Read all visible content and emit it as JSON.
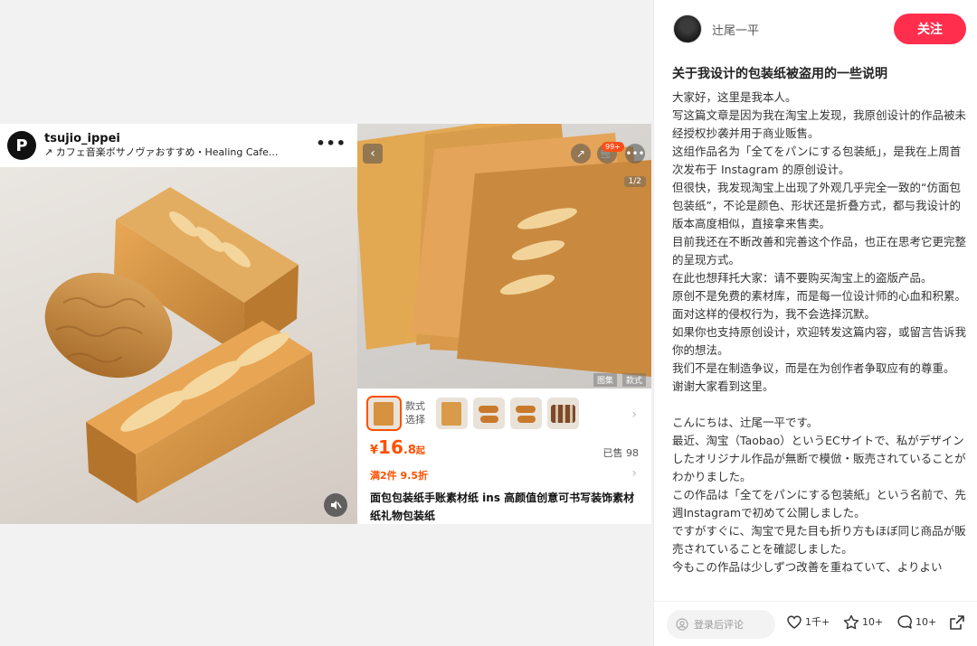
{
  "instagram": {
    "avatar_letter": "P",
    "username": "tsujio_ippei",
    "audio": "↗ カフェ音楽ボサノヴァおすすめ・Healing Cafe...",
    "more": "•••"
  },
  "taobao": {
    "page_indicator": "1/2",
    "cart_badge": "99+",
    "photo_tags": [
      "图集",
      "款式"
    ],
    "style_label": "款式\n选择",
    "price_currency": "¥",
    "price_int": "16",
    "price_dec": ".8",
    "price_suffix": "起",
    "sold": "已售 98",
    "promo": "满2件 9.5折",
    "title": "面包包装纸手账素材纸 ins 高颜值创意可书写装饰素材纸礼物包装纸"
  },
  "post": {
    "author": "辻尾一平",
    "follow_label": "关注",
    "title": "关于我设计的包装纸被盗用的一些说明",
    "paragraphs": [
      "大家好，这里是我本人。",
      "写这篇文章是因为我在淘宝上发现，我原创设计的作品被未经授权抄袭并用于商业贩售。",
      "这组作品名为「全てをパンにする包装紙」，是我在上周首次发布于 Instagram 的原创设计。",
      "但很快，我发现淘宝上出现了外观几乎完全一致的“仿面包包装纸”，不论是颜色、形状还是折叠方式，都与我设计的版本高度相似，直接拿来售卖。",
      "目前我还在不断改善和完善这个作品，也正在思考它更完整的呈现方式。",
      "在此也想拜托大家：请不要购买淘宝上的盗版产品。",
      "原创不是免费的素材库，而是每一位设计师的心血和积累。面对这样的侵权行为，我不会选择沉默。",
      "如果你也支持原创设计，欢迎转发这篇内容，或留言告诉我你的想法。",
      "我们不是在制造争议，而是在为创作者争取应有的尊重。",
      "谢谢大家看到这里。",
      "",
      "こんにちは、辻尾一平です。",
      "最近、淘宝（Taobao）というECサイトで、私がデザインしたオリジナル作品が無断で模倣・販売されていることがわかりました。",
      "この作品は「全てをパンにする包装紙」という名前で、先週Instagramで初めて公開しました。",
      "ですがすぐに、淘宝で見た目も折り方もほぼ同じ商品が販売されていることを確認しました。",
      "今もこの作品は少しずつ改善を重ねていて、よりよい"
    ]
  },
  "footer": {
    "comment_placeholder": "登录后评论",
    "likes": "1千+",
    "stars": "10+",
    "comments": "10+"
  }
}
